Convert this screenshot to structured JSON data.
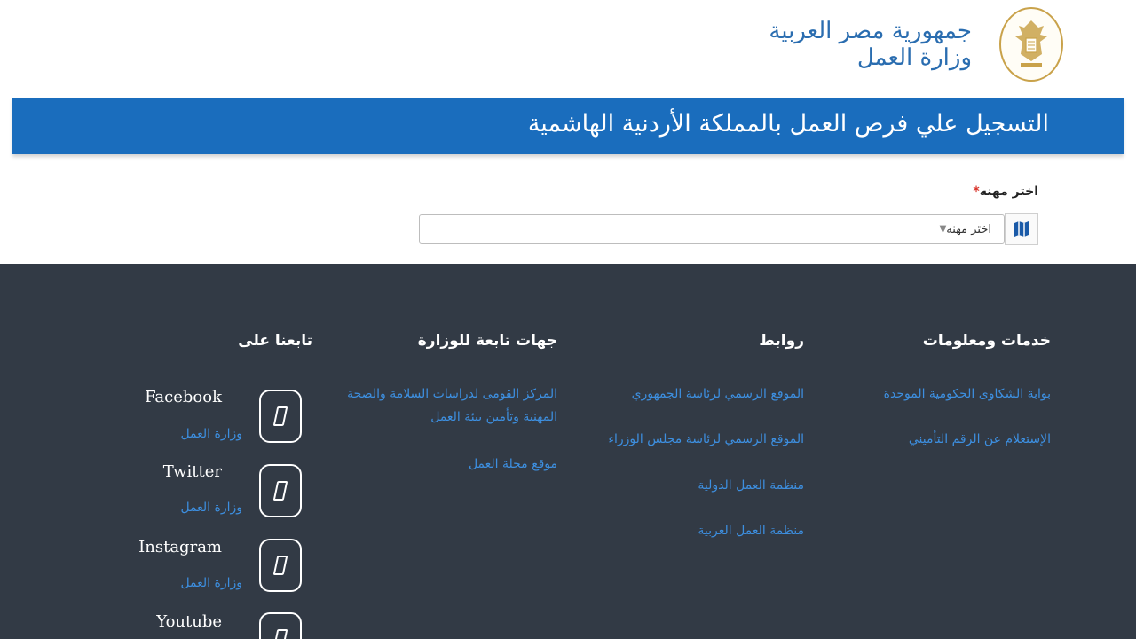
{
  "header": {
    "line1": "جمهورية مصر العربية",
    "line2": "وزارة العمل"
  },
  "banner": {
    "title": "التسجيل علي فرص العمل بالمملكة الأردنية الهاشمية"
  },
  "form": {
    "label": "اختر مهنه",
    "required_mark": "*",
    "select_value": "اختر مهنه"
  },
  "footer": {
    "services": {
      "title": "خدمات ومعلومات",
      "links": [
        "بوابة الشكاوى الحكومية الموحدة",
        "الإستعلام عن الرقم التأميني"
      ]
    },
    "links": {
      "title": "روابط",
      "links": [
        "الموقع الرسمي لرئاسة الجمهوري",
        "الموقع الرسمي لرئاسة مجلس الوزراء",
        "منظمة العمل الدولية",
        "منظمة العمل العربية"
      ]
    },
    "affiliates": {
      "title": "جهات تابعة للوزارة",
      "links": [
        "المركز القومى لدراسات السلامة والصحة المهنية وتأمين بيئة العمل",
        "موقع مجلة العمل"
      ]
    },
    "follow": {
      "title": "تابعنا على",
      "items": [
        {
          "name": "Facebook",
          "sub": "وزارة العمل",
          "icon": "facebook-icon"
        },
        {
          "name": "Twitter",
          "sub": "وزارة العمل",
          "icon": "twitter-icon"
        },
        {
          "name": "Instagram",
          "sub": "وزارة العمل",
          "icon": "instagram-icon"
        },
        {
          "name": "Youtube",
          "sub": "",
          "icon": "youtube-icon"
        }
      ]
    }
  },
  "colors": {
    "banner": "#1a6dbd",
    "footer": "#323a45",
    "link": "#3d8fe0"
  }
}
